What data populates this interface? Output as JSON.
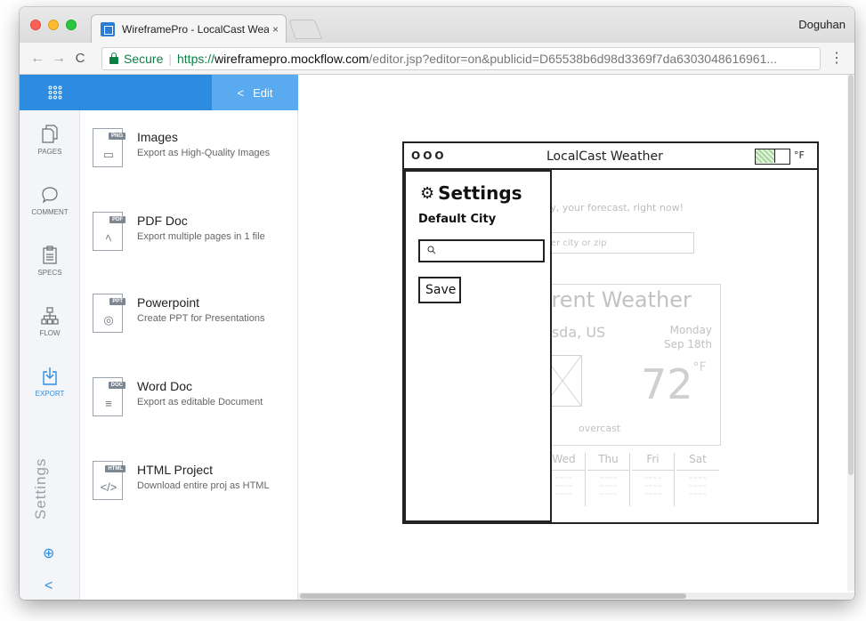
{
  "window": {
    "tab_title": "WireframePro - LocalCast Wea",
    "tab_close": "×",
    "profile_name": "Doguhan"
  },
  "addressbar": {
    "back": "←",
    "forward": "→",
    "reload": "C",
    "secure_label": "Secure",
    "url_scheme": "https://",
    "url_host": "wireframepro.mockflow.com",
    "url_path": "/editor.jsp?editor=on&publicid=D65538b6d98d3369f7da6303048616961...",
    "menu": "⋮"
  },
  "app": {
    "edit_label": "Edit",
    "edit_chevron": "<",
    "rail": [
      {
        "label": "PAGES",
        "icon": "pages-icon"
      },
      {
        "label": "COMMENT",
        "icon": "comment-icon"
      },
      {
        "label": "SPECS",
        "icon": "specs-icon"
      },
      {
        "label": "FLOW",
        "icon": "flow-icon"
      },
      {
        "label": "EXPORT",
        "icon": "export-icon"
      }
    ],
    "settings_vertical": "Settings",
    "zoom_icon": "⊕",
    "back_icon": "<",
    "exports": [
      {
        "badge": "PNG",
        "name": "Images",
        "desc": "Export as High-Quality Images",
        "glyph": "▭"
      },
      {
        "badge": "PDF",
        "name": "PDF Doc",
        "desc": "Export multiple pages in 1 file",
        "glyph": "ﾍ"
      },
      {
        "badge": "PPT",
        "name": "Powerpoint",
        "desc": "Create PPT for Presentations",
        "glyph": "◎"
      },
      {
        "badge": "DOC",
        "name": "Word Doc",
        "desc": "Export as editable Document",
        "glyph": "≡"
      },
      {
        "badge": "HTML",
        "name": "HTML Project",
        "desc": "Download entire proj as HTML",
        "glyph": "</>"
      }
    ]
  },
  "wireframe": {
    "window_controls": "OOO",
    "app_title": "LocalCast Weather",
    "unit_toggle": "°F",
    "tagline": "ty, your forecast, right now!",
    "city_placeholder": "ter city or zip",
    "current_weather": "rrent Weather",
    "location": "esda, US",
    "day": "Monday",
    "date": "Sep 18th",
    "temperature": "72",
    "temperature_unit": "°F",
    "condition": "overcast",
    "week": [
      "Wed",
      "Thu",
      "Fri",
      "Sat"
    ],
    "drawer": {
      "title": "Settings",
      "default_city_label": "Default City",
      "search_icon": "🔍",
      "save_label": "Save"
    }
  }
}
